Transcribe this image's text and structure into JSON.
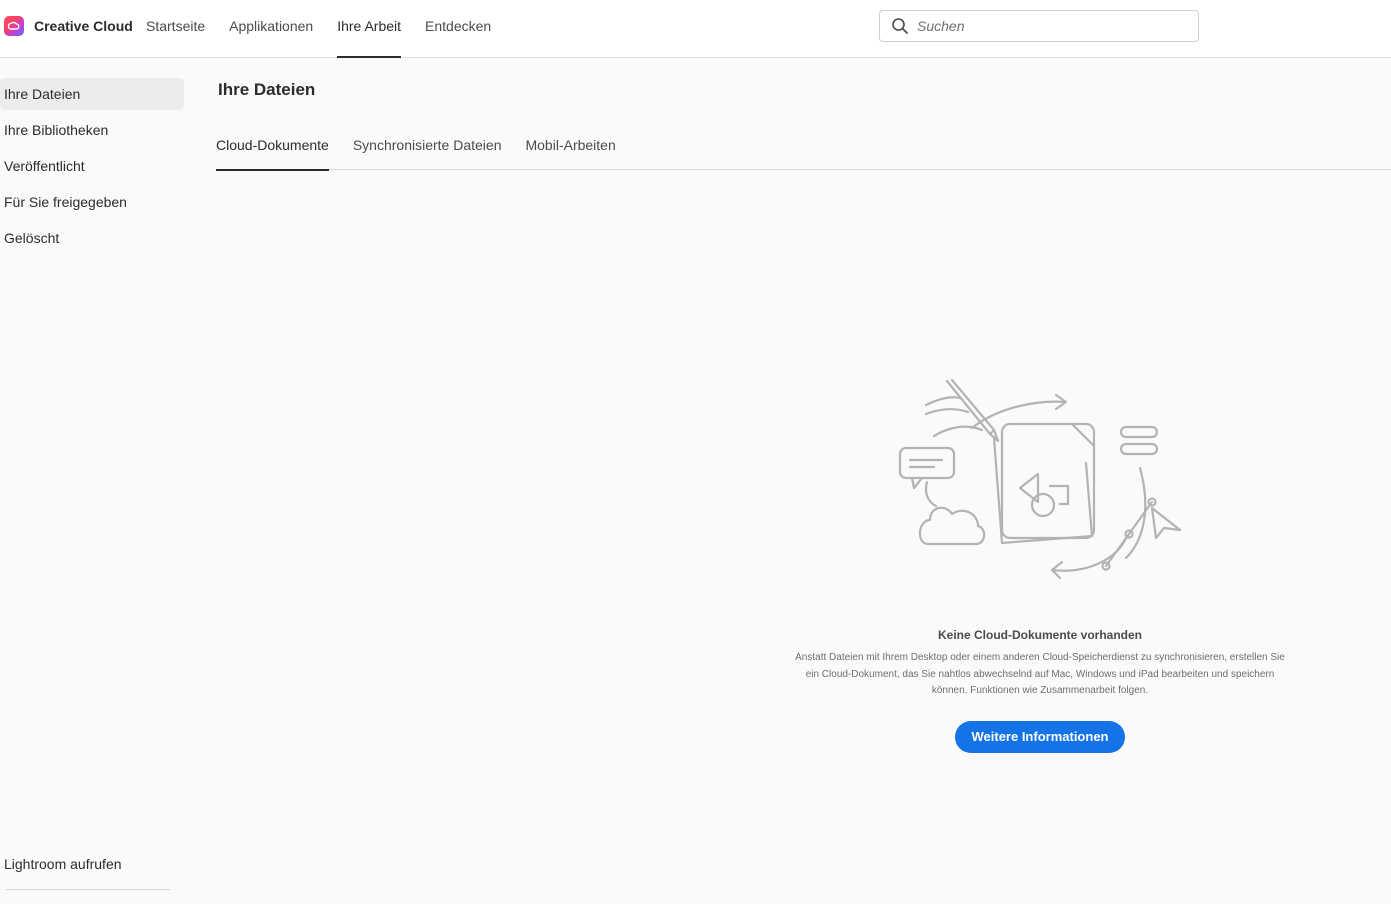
{
  "header": {
    "app_name": "Creative Cloud",
    "nav": [
      {
        "label": "Startseite"
      },
      {
        "label": "Applikationen"
      },
      {
        "label": "Ihre Arbeit",
        "active": true
      },
      {
        "label": "Entdecken"
      }
    ],
    "search_placeholder": "Suchen"
  },
  "sidebar": {
    "items": [
      {
        "label": "Ihre Dateien",
        "active": true
      },
      {
        "label": "Ihre Bibliotheken"
      },
      {
        "label": "Veröffentlicht"
      },
      {
        "label": "Für Sie freigegeben"
      },
      {
        "label": "Gelöscht"
      }
    ],
    "footer_link": "Lightroom aufrufen"
  },
  "main": {
    "title": "Ihre Dateien",
    "tabs": [
      {
        "label": "Cloud-Dokumente",
        "active": true
      },
      {
        "label": "Synchronisierte Dateien"
      },
      {
        "label": "Mobil-Arbeiten"
      }
    ],
    "empty_state": {
      "title": "Keine Cloud-Dokumente vorhanden",
      "description": "Anstatt Dateien mit Ihrem Desktop oder einem anderen Cloud-Speicherdienst zu synchronisieren, erstellen Sie ein Cloud-Dokument, das Sie nahtlos abwechselnd auf Mac, Windows und iPad bearbeiten und speichern können. Funktionen wie Zusammenarbeit folgen.",
      "button_label": "Weitere Informationen"
    }
  },
  "colors": {
    "accent": "#1473e6",
    "background": "#fafafa",
    "header_background": "#ffffff",
    "text": "#2c2c2c",
    "illustration": "#b3b3b3"
  },
  "icons": {
    "logo": "creative-cloud-logo",
    "search": "search-icon",
    "empty_state": "cloud-documents-illustration"
  }
}
